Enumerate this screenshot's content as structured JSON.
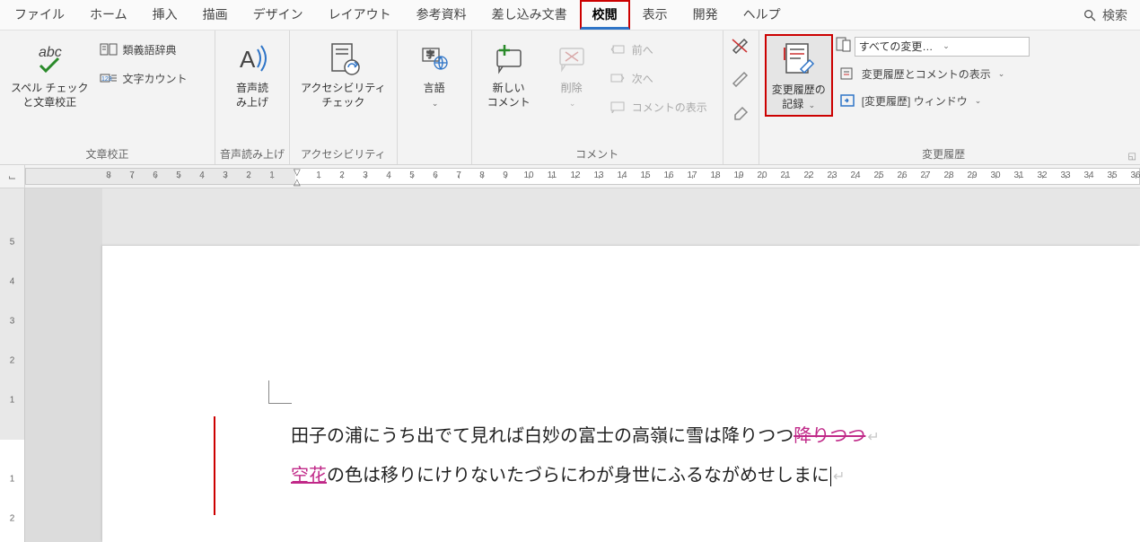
{
  "menu": {
    "items": [
      "ファイル",
      "ホーム",
      "挿入",
      "描画",
      "デザイン",
      "レイアウト",
      "参考資料",
      "差し込み文書",
      "校閲",
      "表示",
      "開発",
      "ヘルプ"
    ],
    "active_index": 8,
    "search": "検索"
  },
  "ribbon": {
    "groups": {
      "proofing": {
        "label": "文章校正",
        "spellcheck": "スペル チェック\nと文章校正",
        "thesaurus": "類義語辞典",
        "wordcount": "文字カウント"
      },
      "speech": {
        "label": "音声読み上げ",
        "readaloud": "音声読\nみ上げ"
      },
      "accessibility": {
        "label": "アクセシビリティ",
        "check": "アクセシビリティ\nチェック"
      },
      "language": {
        "label": "",
        "lang": "言語"
      },
      "comments": {
        "label": "コメント",
        "new": "新しい\nコメント",
        "delete": "削除",
        "prev": "前へ",
        "next": "次へ",
        "show": "コメントの表示"
      },
      "ink": {
        "label": ""
      },
      "tracking": {
        "label": "変更履歴",
        "track": "変更履歴の\n記録",
        "display_select": "すべての変更履歴/コメ…",
        "show_markup": "変更履歴とコメントの表示",
        "reviewing_pane": "[変更履歴] ウィンドウ"
      }
    }
  },
  "ruler_corner": "⌙",
  "document": {
    "line1_before": "田子の浦にうち出でて見れば白妙の富士の高嶺に雪は降りつつ",
    "line1_deleted": "降りつつ",
    "line2_inserted": "空花",
    "line2_after": "の色は移りにけりないたづらにわが身世にふるながめせしまに"
  }
}
